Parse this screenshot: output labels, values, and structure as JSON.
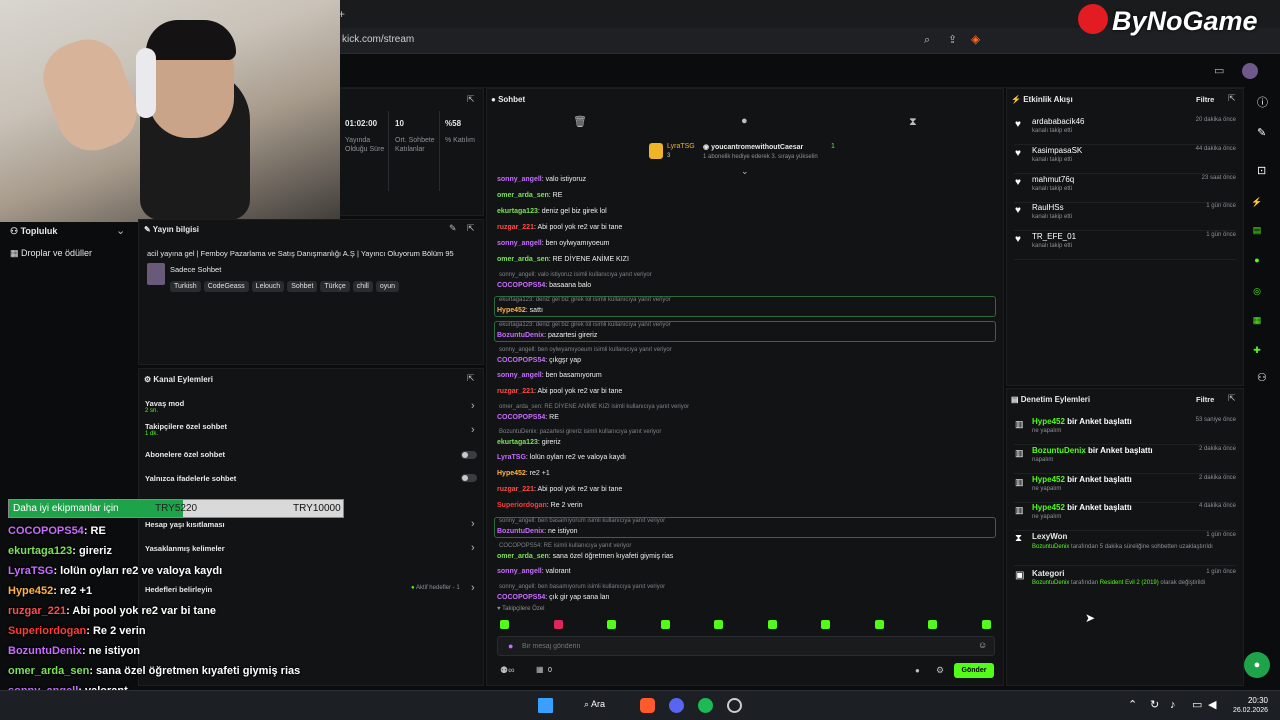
{
  "browser": {
    "url": "kick.com/stream",
    "new_tab": "+"
  },
  "brand": {
    "logo": "ByNoGame"
  },
  "stats": {
    "items": [
      {
        "value": "01:02:00",
        "label": "Yayında Olduğu Süre"
      },
      {
        "value": "10",
        "label": "Ort. Sohbete Katılanlar"
      },
      {
        "value": "%58",
        "label": "% Katılım"
      }
    ]
  },
  "left_nav": {
    "items": [
      "Topluluk",
      "Droplar ve ödüller"
    ]
  },
  "stream_info": {
    "title": "Yayın bilgisi",
    "description": "acil yayına gel | Femboy Pazarlama ve Satış Danışmanlığı A.Ş | Yayıncı Oluyorum Bölüm 95",
    "category": "Sadece Sohbet",
    "tags": [
      "Turkish",
      "CodeGeass",
      "Lelouch",
      "Sohbet",
      "Türkçe",
      "chill",
      "oyun"
    ]
  },
  "channel_actions": {
    "title": "Kanal Eylemleri",
    "items": [
      {
        "label": "Yavaş mod",
        "sub": "2 sn."
      },
      {
        "label": "Takipçilere özel sohbet",
        "sub": "1 dk."
      },
      {
        "label": "Abonelere özel sohbet",
        "sub": ""
      },
      {
        "label": "Yalnızca ifadelerle sohbet",
        "sub": ""
      },
      {
        "label": "Hesap yaşı kısıtlaması",
        "sub": ""
      },
      {
        "label": "Yasaklanmış kelimeler",
        "sub": ""
      },
      {
        "label": "Hedefleri belirleyin",
        "sub": ""
      }
    ],
    "goals_note": "Aktif hedefler - 1"
  },
  "donation_bar": {
    "text": "Daha iyi ekipmanlar için",
    "current": "TRY5220",
    "target": "TRY10000",
    "progress": 0.522
  },
  "overlay_chat": [
    {
      "user": "COCOPOPS54",
      "msg": ": RE",
      "color": "#c86dff"
    },
    {
      "user": "ekurtaga123",
      "msg": ": gireriz",
      "color": "#7ee05a"
    },
    {
      "user": "LyraTSG",
      "msg": ": lolün oyları re2 ve valoya kaydı",
      "color": "#c86dff"
    },
    {
      "user": "Hype452",
      "msg": ": re2 +1",
      "color": "#ffb347"
    },
    {
      "user": "ruzgar_221",
      "msg": ": Abi pool yok re2 var bi tane",
      "color": "#ff4d4d"
    },
    {
      "user": "Superiordogan",
      "msg": ": Re 2 verin",
      "color": "#ff3b3b"
    },
    {
      "user": "BozuntuDenix",
      "msg": ": ne istiyon",
      "color": "#c86dff"
    },
    {
      "user": "omer_arda_sen",
      "msg": ": sana özel öğretmen kıyafeti giymiş rias",
      "color": "#7ee05a"
    },
    {
      "user": "sonny_angell",
      "msg": ": valorant",
      "color": "#c86dff"
    },
    {
      "user": "COCOPOPS54",
      "msg": ": çık gir yap sana lan",
      "color": "#c86dff"
    }
  ],
  "chat": {
    "title": "Sohbet",
    "pinned": {
      "user": "LyraTSG",
      "count": "3",
      "gifter": "youcantromewithoutCaesar",
      "gift_count": "1",
      "gift_text": "1 abonelik hediye ederek 3. sıraya yükselin"
    },
    "messages": [
      {
        "type": "msg",
        "user": "sonny_angell",
        "text": ": valo istiyoruz",
        "color": "#c86dff"
      },
      {
        "type": "msg",
        "user": "omer_arda_sen",
        "text": ": RE",
        "color": "#7ee05a"
      },
      {
        "type": "msg",
        "user": "ekurtaga123",
        "text": ": deniz gel biz girek lol",
        "color": "#7ee05a"
      },
      {
        "type": "msg",
        "user": "ruzgar_221",
        "text": ": Abi pool yok re2 var bi tane",
        "color": "#ff4d4d"
      },
      {
        "type": "msg",
        "user": "sonny_angell",
        "text": ": ben oylwyamıyoeum",
        "color": "#c86dff"
      },
      {
        "type": "msg",
        "user": "omer_arda_sen",
        "text": ": RE DİYENE ANİME KIZI",
        "color": "#7ee05a"
      },
      {
        "type": "reply",
        "note": "sonny_angell: valo istiyoruz isimli kullanıcıya yanıt veriyor",
        "user": "COCOPOPS54",
        "text": ": basaana balo",
        "color": "#c86dff"
      },
      {
        "type": "reply",
        "note": "ekurtaga123: deniz gel biz girek lol isimli kullanıcıya yanıt veriyor",
        "user": "Hype452",
        "text": ": sattı",
        "color": "#ffb347"
      },
      {
        "type": "reply",
        "note": "ekurtaga123: deniz gel biz girek lol isimli kullanıcıya yanıt veriyor",
        "user": "BozuntuDenix",
        "text": ": pazartesi gireriz",
        "color": "#c86dff"
      },
      {
        "type": "reply",
        "note": "sonny_angell: ben oylwyamıyoeum isimli kullanıcıya yanıt veriyor",
        "user": "COCOPOPS54",
        "text": ": çıkgşr yap",
        "color": "#c86dff"
      },
      {
        "type": "msg",
        "user": "sonny_angell",
        "text": ": ben basamıyorum",
        "color": "#c86dff"
      },
      {
        "type": "msg",
        "user": "ruzgar_221",
        "text": ": Abi pool yok re2 var bi tane",
        "color": "#ff4d4d"
      },
      {
        "type": "reply",
        "note": "omer_arda_sen: RE DİYENE ANİME KIZI isimli kullanıcıya yanıt veriyor",
        "user": "COCOPOPS54",
        "text": ": RE",
        "color": "#c86dff"
      },
      {
        "type": "reply",
        "note": "BozuntuDenix: pazartesi gireriz isimli kullanıcıya yanıt veriyor",
        "user": "ekurtaga123",
        "text": ": gireriz",
        "color": "#7ee05a"
      },
      {
        "type": "msg",
        "user": "LyraTSG",
        "text": ": lolün oyları re2 ve valoya kaydı",
        "color": "#c86dff"
      },
      {
        "type": "msg",
        "user": "Hype452",
        "text": ": re2 +1",
        "color": "#ffb347"
      },
      {
        "type": "msg",
        "user": "ruzgar_221",
        "text": ": Abi pool yok re2 var bi tane",
        "color": "#ff4d4d"
      },
      {
        "type": "msg",
        "user": "Superiordogan",
        "text": ": Re 2 verin",
        "color": "#ff3b3b"
      },
      {
        "type": "reply",
        "note": "sonny_angell: ben basamıyorum isimli kullanıcıya yanıt veriyor",
        "user": "BozuntuDenix",
        "text": ": ne istiyon",
        "color": "#c86dff"
      },
      {
        "type": "reply",
        "note": "COCOPOPS54: RE isimli kullanıcıya yanıt veriyor",
        "user": "omer_arda_sen",
        "text": ": sana özel öğretmen kıyafeti giymiş rias",
        "color": "#7ee05a"
      },
      {
        "type": "msg",
        "user": "sonny_angell",
        "text": ": valorant",
        "color": "#c86dff"
      },
      {
        "type": "reply",
        "note": "sonny_angell: ben basamıyorum isimli kullanıcıya yanıt veriyor",
        "user": "COCOPOPS54",
        "text": ": çık gir yap sana lan",
        "color": "#c86dff"
      }
    ],
    "followers_only": "Takipçilere Özel",
    "placeholder": "Bir mesaj gönderin",
    "send_label": "Gönder",
    "points": "0"
  },
  "activity": {
    "title": "Etkinlik Akışı",
    "filter": "Filtre",
    "items": [
      {
        "name": "ardababacik46",
        "sub": "kanalı takip etti",
        "time": "20 dakika önce"
      },
      {
        "name": "KasimpasaSK",
        "sub": "kanalı takip etti",
        "time": "44 dakika önce"
      },
      {
        "name": "mahmut76q",
        "sub": "kanalı takip etti",
        "time": "23 saat önce"
      },
      {
        "name": "RaulHSs",
        "sub": "kanalı takip etti",
        "time": "1 gün önce"
      },
      {
        "name": "TR_EFE_01",
        "sub": "kanalı takip etti",
        "time": "1 gün önce"
      }
    ]
  },
  "moderation": {
    "title": "Denetim Eylemleri",
    "filter": "Filtre",
    "items": [
      {
        "user": "Hype452",
        "action": " bir Anket başlattı",
        "sub": "ne yapalım",
        "time": "53 saniye önce"
      },
      {
        "user": "BozuntuDenix",
        "action": " bir Anket başlattı",
        "sub": "napalım",
        "time": "2 dakika önce"
      },
      {
        "user": "Hype452",
        "action": " bir Anket başlattı",
        "sub": "ne yapalım",
        "time": "2 dakika önce"
      },
      {
        "user": "Hype452",
        "action": " bir Anket başlattı",
        "sub": "ne yapalım",
        "time": "4 dakika önce"
      }
    ],
    "slow": {
      "name": "LexyWon",
      "user": "BozuntuDenix",
      "text": " tarafından 5 dakika süreliğine sohbetten uzaklaştırıldı",
      "time": "1 gün önce"
    },
    "category": {
      "name": "Kategori",
      "user": "BozuntuDenix",
      "mid": " tarafından ",
      "game": "Resident Evil 2 (2019)",
      "end": " olarak değiştirildi",
      "time": "1 gün önce"
    }
  },
  "taskbar": {
    "search": "Ara",
    "time": "20:30",
    "date": "26.02.2026"
  },
  "colors": {
    "accent": "#53fc18",
    "panel": "#121314",
    "bg": "#0b0c0d"
  }
}
